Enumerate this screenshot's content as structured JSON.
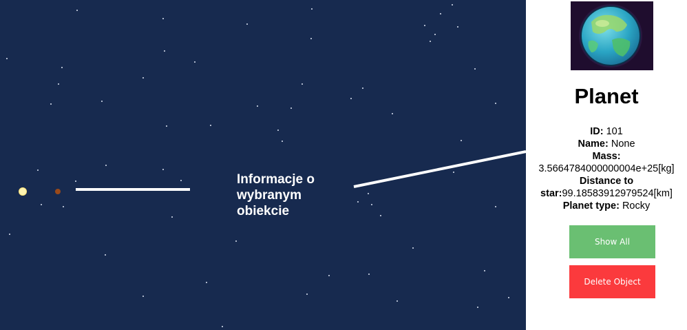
{
  "annotation": {
    "line1": "Informacje o",
    "line2": "wybranym",
    "line3": "obiekcie"
  },
  "panel": {
    "title": "Planet",
    "fields": {
      "id_label": "ID:",
      "id_value": " 101",
      "name_label": "Name:",
      "name_value": " None",
      "mass_label": "Mass:",
      "mass_value": "3.5664784000000004e+25[kg]",
      "distance_label": "Distance to star:",
      "distance_value": "99.18583912979524[km]",
      "type_label": "Planet type:",
      "type_value": " Rocky"
    },
    "buttons": {
      "show_all": "Show All",
      "delete": "Delete Object"
    }
  },
  "colors": {
    "space_bg": "#172a4f",
    "star": "#fff3b0",
    "planet": "#9a4a1a",
    "show_all_bg": "#6abf72",
    "delete_bg": "#fb3a3d"
  }
}
